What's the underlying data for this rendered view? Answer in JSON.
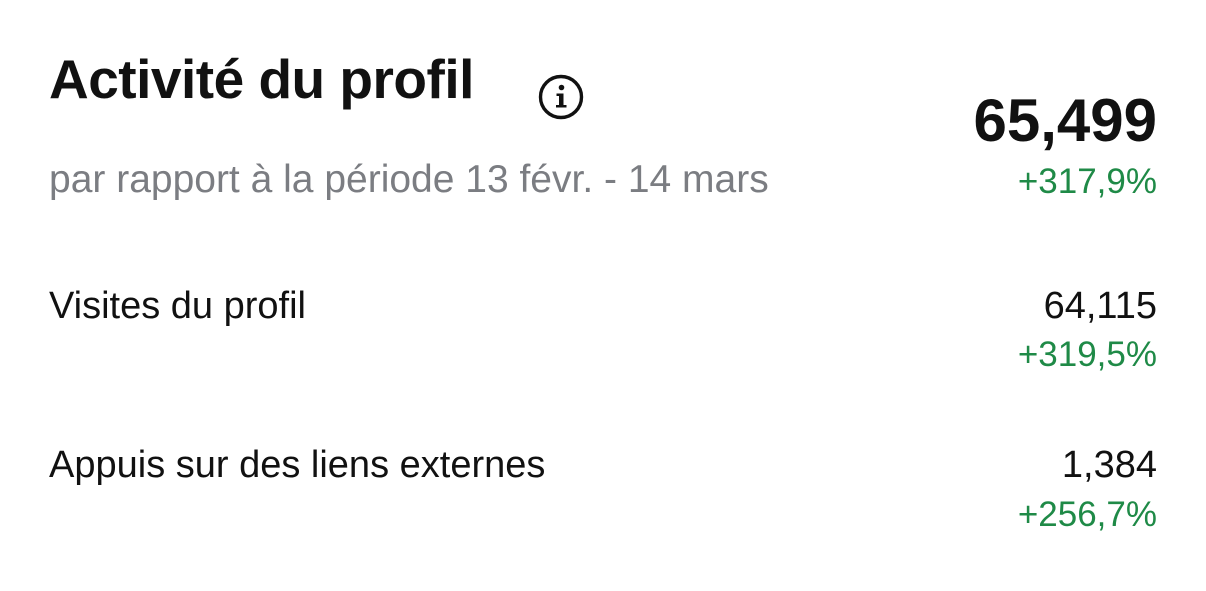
{
  "header": {
    "title": "Activité du profil",
    "info_icon": "info-circle-icon",
    "subtitle": "par rapport à la période 13 févr. - 14 mars",
    "total_value": "65,499",
    "total_change": "+317,9%"
  },
  "metrics": [
    {
      "label": "Visites du profil",
      "value": "64,115",
      "change": "+319,5%"
    },
    {
      "label": "Appuis sur des liens externes",
      "value": "1,384",
      "change": "+256,7%"
    }
  ],
  "colors": {
    "text": "#111111",
    "secondary_text": "#7b7d82",
    "positive_change": "#1f8a47",
    "background": "#ffffff"
  }
}
